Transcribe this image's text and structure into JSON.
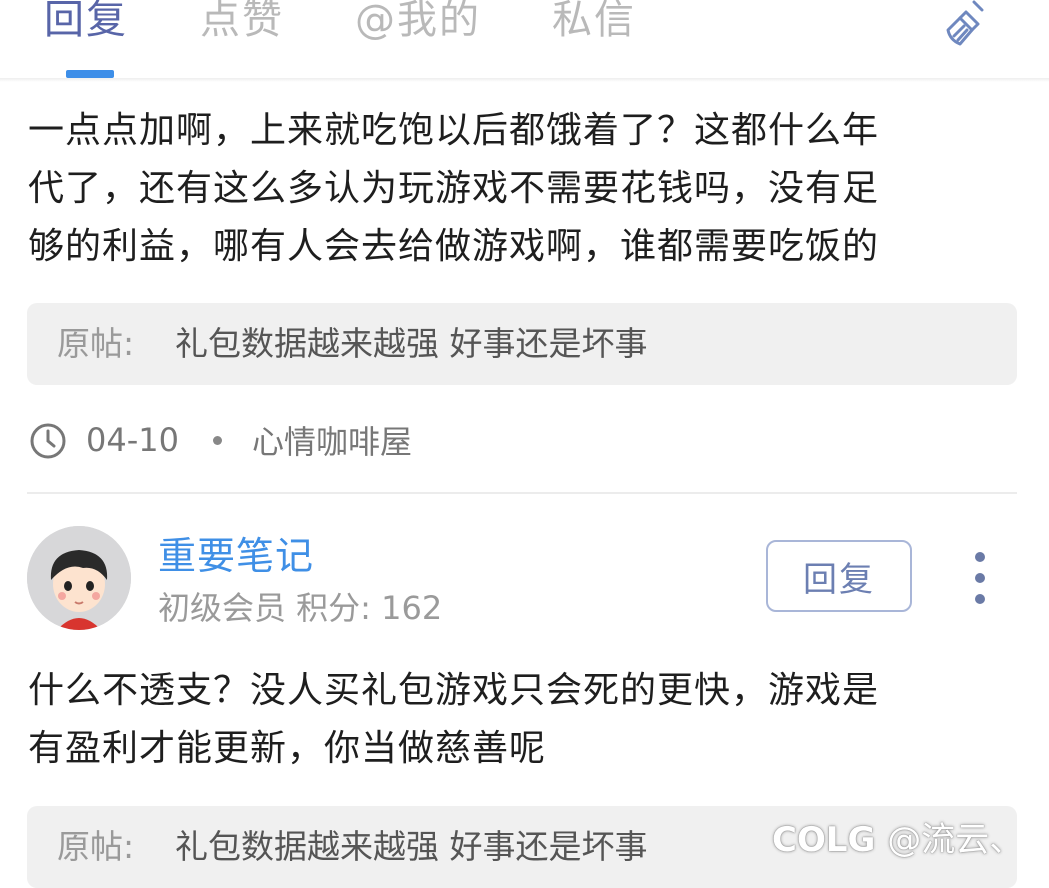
{
  "tabs": {
    "reply": "回复",
    "like": "点赞",
    "mention": "@我的",
    "message": "私信"
  },
  "icons": {
    "clear": "broom-icon",
    "time": "clock-icon",
    "more": "more-vertical-icon"
  },
  "colors": {
    "active_tab": "#5865a8",
    "indicator": "#3d8ee8",
    "username": "#3f8fe6"
  },
  "post1": {
    "lines": [
      "一点点加啊，上来就吃饱以后都饿着了？这都什么年",
      "代了，还有这么多认为玩游戏不需要花钱吗，没有足",
      "够的利益，哪有人会去给做游戏啊，谁都需要吃饭的"
    ],
    "origin_label": "原帖:",
    "origin_title": "礼包数据越来越强  好事还是坏事",
    "date": "04-10",
    "forum": "心情咖啡屋"
  },
  "post2": {
    "username": "重要笔记",
    "level": "初级会员 积分: 162",
    "reply_label": "回复",
    "lines": [
      "什么不透支？没人买礼包游戏只会死的更快，游戏是",
      "有盈利才能更新，你当做慈善呢"
    ],
    "origin_label": "原帖:",
    "origin_title": "礼包数据越来越强  好事还是坏事"
  },
  "watermark": {
    "logo": "COLG",
    "handle": "@流云、"
  }
}
